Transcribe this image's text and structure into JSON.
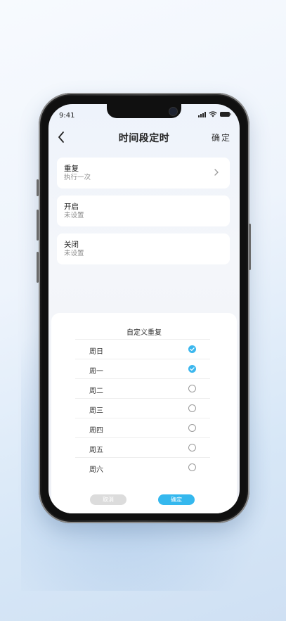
{
  "status": {
    "time": "9:41"
  },
  "nav": {
    "title": "时间段定时",
    "confirm": "确定"
  },
  "settings": [
    {
      "label": "重复",
      "value": "执行一次",
      "has_arrow": true
    },
    {
      "label": "开启",
      "value": "未设置",
      "has_arrow": false
    },
    {
      "label": "关闭",
      "value": "未设置",
      "has_arrow": false
    }
  ],
  "sheet": {
    "title": "自定义重复",
    "days": [
      {
        "name": "周日",
        "checked": true
      },
      {
        "name": "周一",
        "checked": true
      },
      {
        "name": "周二",
        "checked": false
      },
      {
        "name": "周三",
        "checked": false
      },
      {
        "name": "周四",
        "checked": false
      },
      {
        "name": "周五",
        "checked": false
      },
      {
        "name": "周六",
        "checked": false
      }
    ],
    "cancel_label": "取消",
    "ok_label": "确定"
  },
  "colors": {
    "accent": "#3cb7ee",
    "cancel_bg": "#dcdcdc"
  },
  "icons": [
    "back-arrow-icon",
    "chevron-right-icon",
    "signal-icon",
    "wifi-icon",
    "battery-icon",
    "check-circle-icon"
  ]
}
